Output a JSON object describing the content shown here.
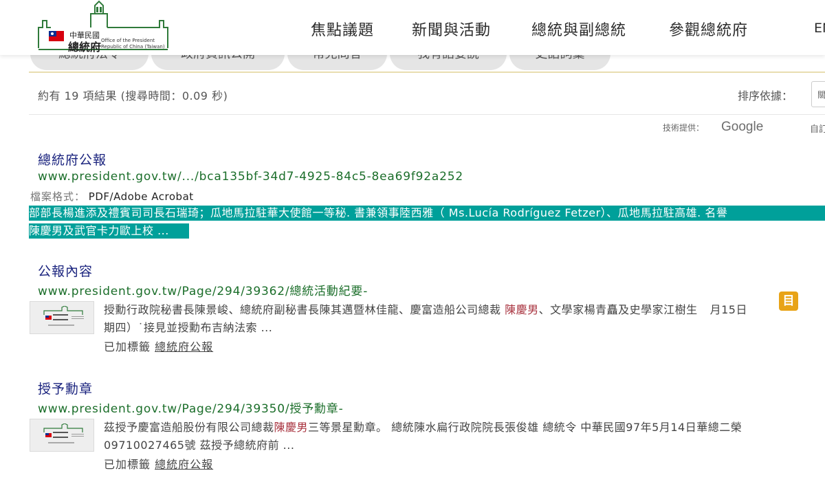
{
  "header": {
    "logo": {
      "zh_top": "中華民國",
      "zh_main": "總統府",
      "en_line1": "Office of the President",
      "en_line2": "Republic of China (Taiwan)"
    },
    "nav": [
      "焦點議題",
      "新聞與活動",
      "總統與副總統",
      "參觀總統府"
    ],
    "lang": "EN"
  },
  "tabs": [
    "總統府法令",
    "政府資訊公開",
    "常見問答",
    "我有話要說",
    "史語詞彙"
  ],
  "results_meta": {
    "stats": "約有 19 項結果 (搜尋時間：0.09 秒)",
    "sort_label": "排序依據：",
    "sort_value": "關聯",
    "powered_by": "技術提供：",
    "powered_brand": "Google",
    "custom": "自訂"
  },
  "results": [
    {
      "title": "總統府公報",
      "url": "www.president.gov.tw/.../bca135bf-34d7-4925-84c5-8ea69f92a252",
      "format_label": "檔案格式：",
      "format_value": "PDF/Adobe Acrobat",
      "snippet_line1": "部部長楊進添及禮賓司司長石瑞琦；瓜地馬拉駐華大使館一等秘. 書兼領事陸西雅（ Ms.Lucía Rodríguez Fetzer）、瓜地馬拉駐高雄. 名譽",
      "snippet_line2": "陳慶男及武官卡力歐上校 ..."
    },
    {
      "title": "公報內容",
      "url": "www.president.gov.tw/Page/294/39362/總統活動紀要-",
      "snippet_a": "授勳行政院秘書長陳景峻、總統府副秘書長陳其邁暨林佳龍、慶富造船公司總裁 ",
      "snippet_red": "陳慶男",
      "snippet_b": "、文學家楊青矗及史學家江樹生",
      "snippet_c": "月15日",
      "snippet_line2": "期四）˙接見並授勳布吉納法索 ...",
      "tag_label": "已加標籤 ",
      "tag_link": "總統府公報"
    },
    {
      "title": "授予勳章",
      "url": "www.president.gov.tw/Page/294/39350/授予勳章-",
      "snippet_a": "茲授予慶富造船股份有限公司總裁",
      "snippet_red": "陳慶男",
      "snippet_b": "三等景星勳章。 總統陳水扁行政院院長張俊雄 總統令 中華民國97年5月14日華總二榮",
      "snippet_line2": "09710027465號 茲授予總統府前 ...",
      "tag_label": "已加標籤 ",
      "tag_link": "總統府公報"
    }
  ],
  "badge_char": "目",
  "colors": {
    "title_blue": "#1a237e",
    "url_green": "#1b6e2a",
    "highlight_teal": "#00a09a",
    "name_red": "#a8323e",
    "gold": "#e8ddb0"
  }
}
